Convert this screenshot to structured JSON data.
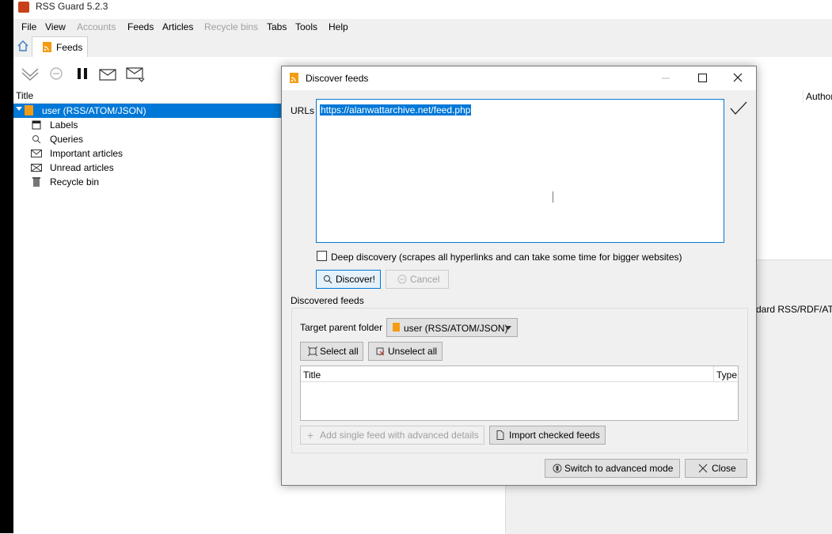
{
  "window": {
    "title": "RSS Guard 5.2.3"
  },
  "menu": {
    "items": [
      {
        "label": "File",
        "disabled": false
      },
      {
        "label": "View",
        "disabled": false
      },
      {
        "label": "Accounts",
        "disabled": true
      },
      {
        "label": "Feeds",
        "disabled": false
      },
      {
        "label": "Articles",
        "disabled": false
      },
      {
        "label": "Recycle bins",
        "disabled": true
      },
      {
        "label": "Tabs",
        "disabled": false
      },
      {
        "label": "Tools",
        "disabled": false
      },
      {
        "label": "Help",
        "disabled": false
      }
    ]
  },
  "tabs": {
    "feeds_label": "Feeds"
  },
  "feeds_list": {
    "header": "Title",
    "items": [
      {
        "label": "user (RSS/ATOM/JSON)",
        "icon": "rss-feed-icon",
        "selected": true
      },
      {
        "label": "Labels",
        "icon": "labels-icon"
      },
      {
        "label": "Queries",
        "icon": "search-icon"
      },
      {
        "label": "Important articles",
        "icon": "important-mail-icon"
      },
      {
        "label": "Unread articles",
        "icon": "unread-mail-icon"
      },
      {
        "label": "Recycle bin",
        "icon": "trash-icon"
      }
    ]
  },
  "articles": {
    "author_header": "Author",
    "preview_fragment": "dard RSS/RDF/ATO"
  },
  "dialog": {
    "title": "Discover feeds",
    "urls_label": "URLs",
    "url_value": "https://alanwattarchive.net/feed.php",
    "deep_discovery_label": "Deep discovery (scrapes all hyperlinks and can take some time for bigger websites)",
    "deep_discovery_checked": false,
    "discover_button": "Discover!",
    "cancel_button": "Cancel",
    "discovered_group_title": "Discovered feeds",
    "target_folder_label": "Target parent folder",
    "target_folder_value": "user (RSS/ATOM/JSON)",
    "select_all_button": "Select all",
    "unselect_all_button": "Unselect all",
    "table_headers": [
      "Title",
      "Type"
    ],
    "add_single_feed_button": "Add single feed with advanced details",
    "import_checked_button": "Import checked feeds",
    "switch_advanced_button": "Switch to advanced mode",
    "close_button": "Close"
  },
  "colors": {
    "accent": "#0078d7",
    "rss_orange": "#f39c12",
    "window_bg": "#f0f0f0"
  }
}
